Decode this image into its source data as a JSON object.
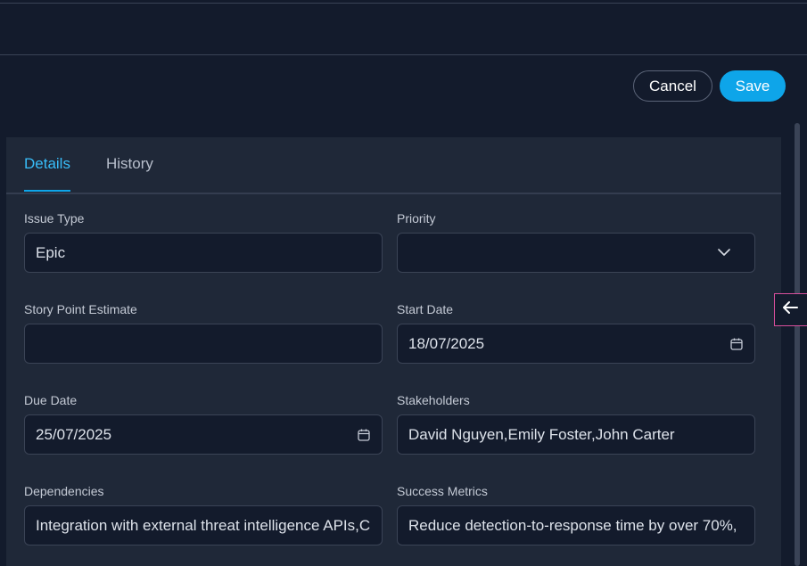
{
  "header": {
    "cancel_label": "Cancel",
    "save_label": "Save"
  },
  "tabs": [
    {
      "label": "Details",
      "active": true
    },
    {
      "label": "History",
      "active": false
    }
  ],
  "form": {
    "issue_type": {
      "label": "Issue Type",
      "value": "Epic"
    },
    "priority": {
      "label": "Priority",
      "value": ""
    },
    "story_points": {
      "label": "Story Point Estimate",
      "value": ""
    },
    "start_date": {
      "label": "Start Date",
      "value": "18/07/2025"
    },
    "due_date": {
      "label": "Due Date",
      "value": "25/07/2025"
    },
    "stakeholders": {
      "label": "Stakeholders",
      "value": "David Nguyen,Emily Foster,John Carter"
    },
    "dependencies": {
      "label": "Dependencies",
      "value": "Integration with external threat intelligence APIs,C"
    },
    "success_metrics": {
      "label": "Success Metrics",
      "value": "Reduce detection-to-response time by over 70%,"
    }
  },
  "icons": {
    "calendar": "calendar-icon",
    "chevron": "chevron-down-icon",
    "arrow": "arrow-left-icon"
  },
  "colors": {
    "accent": "#0ea5e9",
    "background": "#131b2c",
    "panel": "#1f2838"
  }
}
